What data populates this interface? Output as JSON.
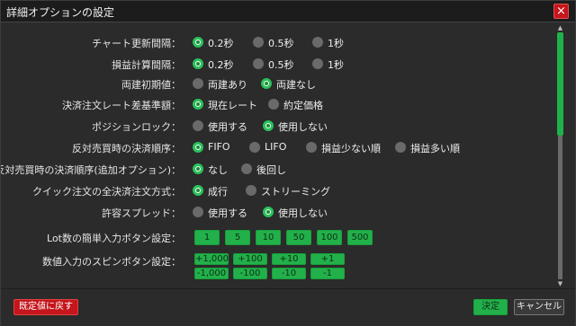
{
  "window": {
    "title": "詳細オプションの設定",
    "close_icon": "×"
  },
  "settings": [
    {
      "label": "チャート更新間隔：",
      "options": [
        "0.2秒",
        "0.5秒",
        "1秒"
      ],
      "selected": 0
    },
    {
      "label": "損益計算間隔：",
      "options": [
        "0.2秒",
        "0.5秒",
        "1秒"
      ],
      "selected": 0
    },
    {
      "label": "両建初期値：",
      "options": [
        "両建あり",
        "両建なし"
      ],
      "selected": 1
    },
    {
      "label": "決済注文レート差基準額：",
      "options": [
        "現在レート",
        "約定価格"
      ],
      "selected": 0
    },
    {
      "label": "ポジションロック：",
      "options": [
        "使用する",
        "使用しない"
      ],
      "selected": 1
    },
    {
      "label": "反対売買時の決済順序：",
      "options": [
        "FIFO",
        "LIFO",
        "損益少ない順",
        "損益多い順"
      ],
      "selected": 0
    },
    {
      "label": "反対売買時の決済順序(追加オプション)：",
      "options": [
        "なし",
        "後回し"
      ],
      "selected": 0
    },
    {
      "label": "クイック注文の全決済注文方式：",
      "options": [
        "成行",
        "ストリーミング"
      ],
      "selected": 0
    },
    {
      "label": "許容スプレッド：",
      "options": [
        "使用する",
        "使用しない"
      ],
      "selected": 1
    }
  ],
  "lot_buttons": {
    "label": "Lot数の簡単入力ボタン設定：",
    "values": [
      "1",
      "5",
      "10",
      "50",
      "100",
      "500"
    ]
  },
  "spin_buttons": {
    "label": "数値入力のスピンボタン設定：",
    "plus": [
      "+1,000",
      "+100",
      "+10",
      "+1"
    ],
    "minus": [
      "-1,000",
      "-100",
      "-10",
      "-1"
    ]
  },
  "footer": {
    "reset_label": "既定値に戻す",
    "ok_label": "決定",
    "cancel_label": "キャンセル"
  },
  "colors": {
    "accent_green": "#22b04a",
    "danger_red": "#c4161c",
    "background": "#2b2b2b"
  },
  "icons": {
    "scroll_up": "▲",
    "scroll_down": "▼"
  }
}
